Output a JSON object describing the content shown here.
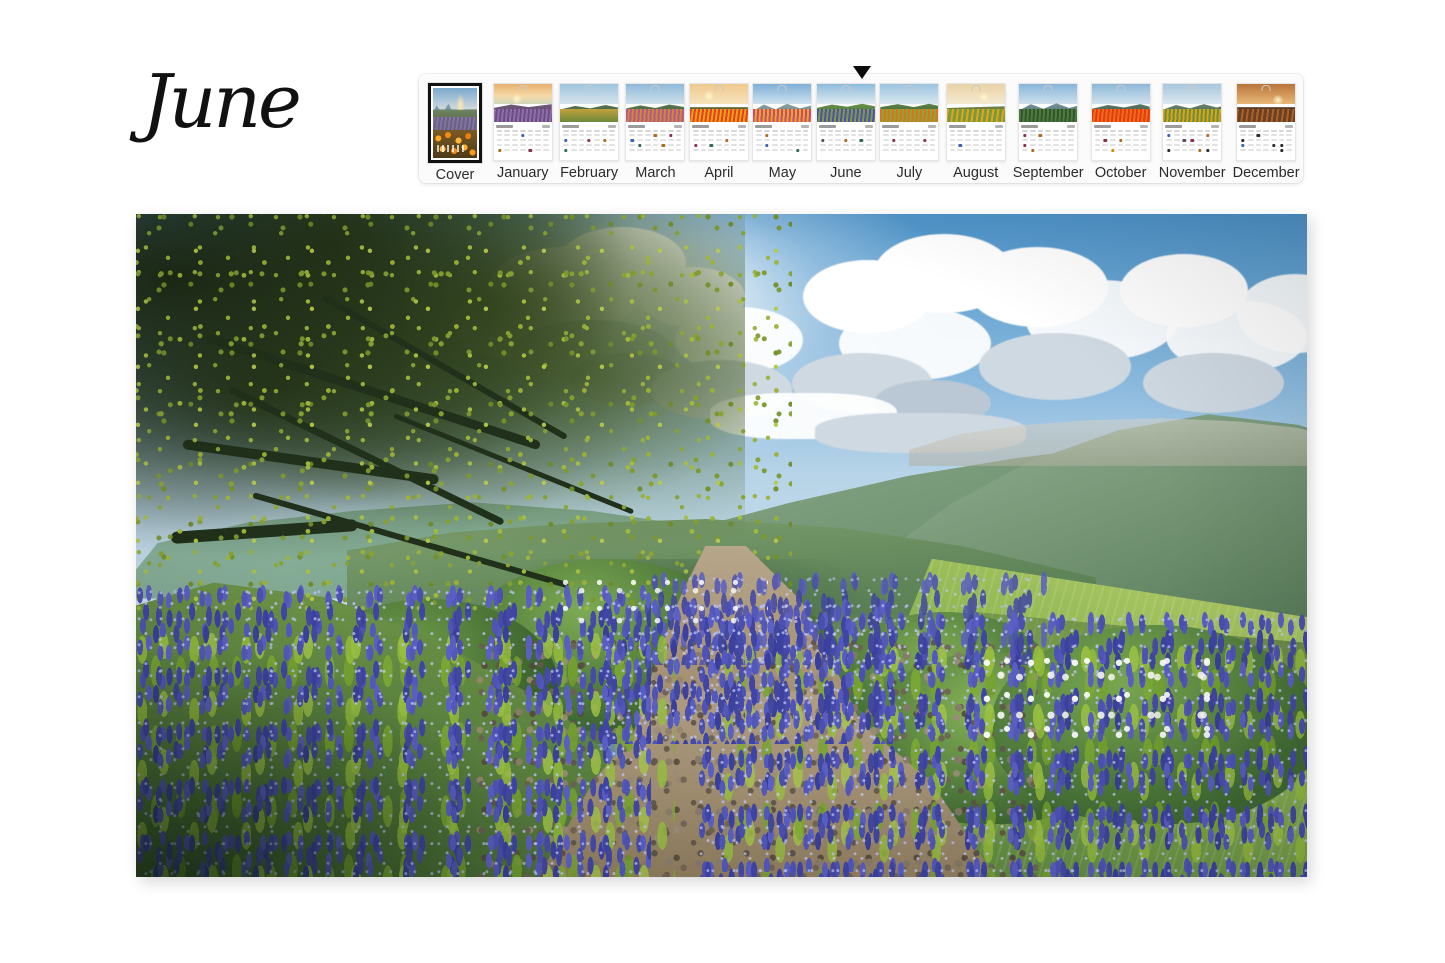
{
  "page": {
    "background_color": "#ffffff",
    "title": "June"
  },
  "month_title": {
    "text": "June",
    "color": "#111111",
    "style": "handwritten-script"
  },
  "selection_pointer": {
    "icon": "triangle-down-icon",
    "points_to": "June",
    "color": "#0b0b0b"
  },
  "thumbnail_strip": {
    "background_color": "#fbfbfb",
    "selected_index": 0,
    "pointer_index": 6,
    "items": [
      {
        "label": "Cover",
        "type": "cover",
        "selected": true
      },
      {
        "label": "January",
        "type": "month",
        "selected": false
      },
      {
        "label": "February",
        "type": "month",
        "selected": false
      },
      {
        "label": "March",
        "type": "month",
        "selected": false
      },
      {
        "label": "April",
        "type": "month",
        "selected": false
      },
      {
        "label": "May",
        "type": "month",
        "selected": false
      },
      {
        "label": "June",
        "type": "month",
        "selected": false
      },
      {
        "label": "July",
        "type": "month",
        "selected": false
      },
      {
        "label": "August",
        "type": "month",
        "selected": false
      },
      {
        "label": "September",
        "type": "month",
        "selected": false
      },
      {
        "label": "October",
        "type": "month",
        "selected": false
      },
      {
        "label": "November",
        "type": "month",
        "selected": false
      },
      {
        "label": "December",
        "type": "month",
        "selected": false
      }
    ]
  },
  "preview": {
    "name": "june-calendar-photo",
    "description": "Sunlit green valley with a rocky dirt trail winding through a hillside of blue lupine wildflowers, a large oak tree at left and towering cumulus clouds above rolling hills",
    "colors": {
      "sky_blue": "#66a4d2",
      "cloud_white": "#ffffff",
      "hill_green": "#6f9a47",
      "flower_blue": "#4b4fb0",
      "trail_tan": "#a99578",
      "foliage_dark": "#2f5428"
    }
  }
}
